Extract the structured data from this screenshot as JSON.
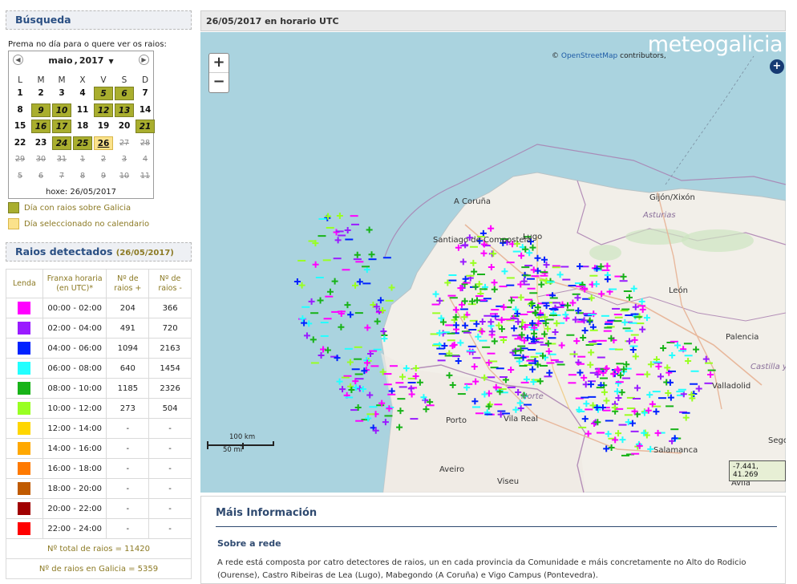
{
  "search": {
    "header": "Búsqueda",
    "prompt": "Prema no día para o quere ver os raios:",
    "calendar": {
      "month": "maio",
      "year": "2017",
      "weekdays": [
        "L",
        "M",
        "M",
        "X",
        "V",
        "S",
        "D"
      ],
      "weeks": [
        [
          {
            "d": "1",
            "s": "normal"
          },
          {
            "d": "2",
            "s": "normal"
          },
          {
            "d": "3",
            "s": "normal"
          },
          {
            "d": "4",
            "s": "normal"
          },
          {
            "d": "5",
            "s": "lightning"
          },
          {
            "d": "6",
            "s": "lightning"
          },
          {
            "d": "7",
            "s": "normal"
          }
        ],
        [
          {
            "d": "8",
            "s": "normal"
          },
          {
            "d": "9",
            "s": "lightning"
          },
          {
            "d": "10",
            "s": "lightning"
          },
          {
            "d": "11",
            "s": "normal"
          },
          {
            "d": "12",
            "s": "lightning"
          },
          {
            "d": "13",
            "s": "lightning"
          },
          {
            "d": "14",
            "s": "normal"
          }
        ],
        [
          {
            "d": "15",
            "s": "normal"
          },
          {
            "d": "16",
            "s": "lightning"
          },
          {
            "d": "17",
            "s": "lightning"
          },
          {
            "d": "18",
            "s": "normal"
          },
          {
            "d": "19",
            "s": "normal"
          },
          {
            "d": "20",
            "s": "normal"
          },
          {
            "d": "21",
            "s": "lightning"
          }
        ],
        [
          {
            "d": "22",
            "s": "normal"
          },
          {
            "d": "23",
            "s": "normal"
          },
          {
            "d": "24",
            "s": "lightning"
          },
          {
            "d": "25",
            "s": "lightning"
          },
          {
            "d": "26",
            "s": "selected"
          },
          {
            "d": "27",
            "s": "out"
          },
          {
            "d": "28",
            "s": "out"
          }
        ],
        [
          {
            "d": "29",
            "s": "out"
          },
          {
            "d": "30",
            "s": "out"
          },
          {
            "d": "31",
            "s": "out"
          },
          {
            "d": "1",
            "s": "out"
          },
          {
            "d": "2",
            "s": "out"
          },
          {
            "d": "3",
            "s": "out"
          },
          {
            "d": "4",
            "s": "out"
          }
        ],
        [
          {
            "d": "5",
            "s": "out"
          },
          {
            "d": "6",
            "s": "out"
          },
          {
            "d": "7",
            "s": "out"
          },
          {
            "d": "8",
            "s": "out"
          },
          {
            "d": "9",
            "s": "out"
          },
          {
            "d": "10",
            "s": "out"
          },
          {
            "d": "11",
            "s": "out"
          }
        ]
      ],
      "today": "hoxe: 26/05/2017"
    },
    "legend": [
      {
        "label": "Día con raios sobre Galicia",
        "color": "#a9ae2e"
      },
      {
        "label": "Día seleccionado no calendario",
        "color": "#fbe28b"
      }
    ]
  },
  "detected": {
    "header": "Raios detectados",
    "date": "(26/05/2017)",
    "columns": [
      "Lenda",
      "Franxa horaria (en UTC)*",
      "Nº de raios +",
      "Nº de raios -"
    ],
    "rows": [
      {
        "color": "#ff00ff",
        "range": "00:00 - 02:00",
        "pos": "204",
        "neg": "366"
      },
      {
        "color": "#9a1bff",
        "range": "02:00 - 04:00",
        "pos": "491",
        "neg": "720"
      },
      {
        "color": "#0022ff",
        "range": "04:00 - 06:00",
        "pos": "1094",
        "neg": "2163"
      },
      {
        "color": "#22ffff",
        "range": "06:00 - 08:00",
        "pos": "640",
        "neg": "1454"
      },
      {
        "color": "#17b317",
        "range": "08:00 - 10:00",
        "pos": "1185",
        "neg": "2326"
      },
      {
        "color": "#99ff22",
        "range": "10:00 - 12:00",
        "pos": "273",
        "neg": "504"
      },
      {
        "color": "#ffd600",
        "range": "12:00 - 14:00",
        "pos": "-",
        "neg": "-"
      },
      {
        "color": "#ffa800",
        "range": "14:00 - 16:00",
        "pos": "-",
        "neg": "-"
      },
      {
        "color": "#ff7a00",
        "range": "16:00 - 18:00",
        "pos": "-",
        "neg": "-"
      },
      {
        "color": "#c05a00",
        "range": "18:00 - 20:00",
        "pos": "-",
        "neg": "-"
      },
      {
        "color": "#a00000",
        "range": "20:00 - 22:00",
        "pos": "-",
        "neg": "-"
      },
      {
        "color": "#ff0000",
        "range": "22:00 - 24:00",
        "pos": "-",
        "neg": "-"
      }
    ],
    "total": "Nº total de raios = 11420",
    "galicia": "Nº de raios en Galicia = 5359"
  },
  "map": {
    "header": "26/05/2017 en horario UTC",
    "zoom_in": "+",
    "zoom_out": "−",
    "attribution_prefix": "©",
    "attribution_link": "OpenStreetMap",
    "attribution_suffix": "contributors,",
    "brand": "meteogalicia",
    "layers_icon": "+",
    "scale_km": "100 km",
    "scale_mi": "50 mi",
    "coords": "-7.441, 41.269",
    "places": [
      {
        "name": "A Coruña",
        "type": "city"
      },
      {
        "name": "Gijón/Xixón",
        "type": "city"
      },
      {
        "name": "Asturias",
        "type": "region"
      },
      {
        "name": "Santiago de Compostela",
        "type": "city"
      },
      {
        "name": "Lugo",
        "type": "city"
      },
      {
        "name": "León",
        "type": "city"
      },
      {
        "name": "Palencia",
        "type": "city"
      },
      {
        "name": "Castilla y",
        "type": "region"
      },
      {
        "name": "Valladolid",
        "type": "city"
      },
      {
        "name": "Norte",
        "type": "region"
      },
      {
        "name": "Porto",
        "type": "city"
      },
      {
        "name": "Vila Real",
        "type": "city"
      },
      {
        "name": "Salamanca",
        "type": "city"
      },
      {
        "name": "Aveiro",
        "type": "city"
      },
      {
        "name": "Viseu",
        "type": "city"
      },
      {
        "name": "Segov",
        "type": "city"
      },
      {
        "name": "Ávila",
        "type": "city"
      }
    ]
  },
  "info": {
    "title": "Máis Información",
    "subtitle": "Sobre a rede",
    "text": "A rede está composta por catro detectores de raios, un en cada provincia da Comunidade e máis concretamente no Alto do Rodicio (Ourense), Castro Ribeiras de Lea (Lugo), Mabegondo (A Coruña) e Vigo Campus (Pontevedra)."
  }
}
